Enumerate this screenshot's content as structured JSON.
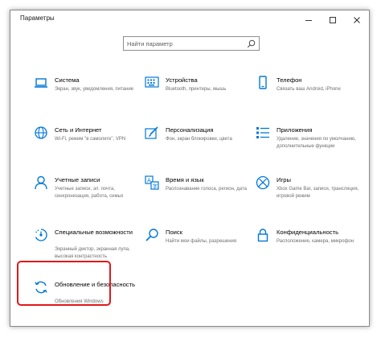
{
  "window": {
    "title": "Параметры"
  },
  "search": {
    "placeholder": "Найти параметр"
  },
  "colors": {
    "accent": "#0078d7",
    "highlight": "#e01919"
  },
  "tiles": [
    {
      "icon": "laptop-icon",
      "name": "Система",
      "description": "Экран, звук, уведомления, питание"
    },
    {
      "icon": "keyboard-icon",
      "name": "Устройства",
      "description": "Bluetooth, принтеры, мышь"
    },
    {
      "icon": "phone-icon",
      "name": "Телефон",
      "description": "Связать ваш Android, iPhone"
    },
    {
      "icon": "globe-icon",
      "name": "Сеть и Интернет",
      "description": "Wi-Fi, режим \"в самолете\", VPN"
    },
    {
      "icon": "paint-brush-icon",
      "name": "Персонализация",
      "description": "Фон, экран блокировки, цвета"
    },
    {
      "icon": "apps-icon",
      "name": "Приложения",
      "description": "Удаление, значения по умолчанию, дополнительные функции"
    },
    {
      "icon": "user-icon",
      "name": "Учетные записи",
      "description": "Учетные записи, эл. почта, синхронизация, работа, семья"
    },
    {
      "icon": "time-language-icon",
      "name": "Время и язык",
      "description": "Распознавание голоса, регион, дата"
    },
    {
      "icon": "xbox-icon",
      "name": "Игры",
      "description": "Xbox Game Bar, записи, трансляция, игровой режим"
    },
    {
      "icon": "ease-of-access-icon",
      "name": "Специальные возможности",
      "description": "Экранный диктор, экранная лупа, высокая контрастность"
    },
    {
      "icon": "search-icon",
      "name": "Поиск",
      "description": "Найти мои файлы, разрешения"
    },
    {
      "icon": "lock-icon",
      "name": "Конфиденциальность",
      "description": "Расположение, камера, микрофон"
    },
    {
      "icon": "update-icon",
      "name": "Обновление и безопасность",
      "description": "Обновления Windows"
    }
  ]
}
